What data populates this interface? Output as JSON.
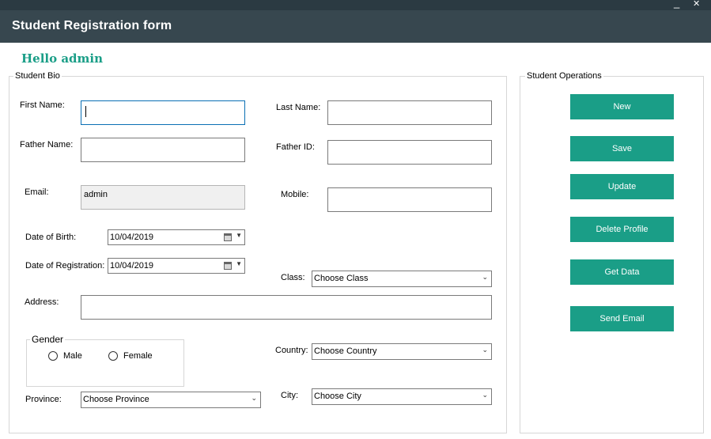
{
  "window": {
    "title": "Student Registration form",
    "minimize_glyph": "_",
    "close_glyph": "✕"
  },
  "greeting": "Hello admin",
  "bio": {
    "legend": "Student Bio",
    "first_name": {
      "label": "First Name:",
      "value": ""
    },
    "last_name": {
      "label": "Last Name:",
      "value": ""
    },
    "father_name": {
      "label": "Father Name:",
      "value": ""
    },
    "father_id": {
      "label": "Father ID:",
      "value": ""
    },
    "email": {
      "label": "Email:",
      "value": "admin"
    },
    "mobile": {
      "label": "Mobile:",
      "value": ""
    },
    "dob": {
      "label": "Date of Birth:",
      "value": "10/04/2019"
    },
    "dor": {
      "label": "Date of Registration:",
      "value": "10/04/2019"
    },
    "class": {
      "label": "Class:",
      "value": "Choose Class"
    },
    "address": {
      "label": "Address:",
      "value": ""
    },
    "gender": {
      "legend": "Gender",
      "male": "Male",
      "female": "Female"
    },
    "country": {
      "label": "Country:",
      "value": "Choose Country"
    },
    "province": {
      "label": "Province:",
      "value": "Choose Province"
    },
    "city": {
      "label": "City:",
      "value": "Choose City"
    }
  },
  "operations": {
    "legend": "Student Operations",
    "new": "New",
    "save": "Save",
    "update": "Update",
    "delete": "Delete Profile",
    "get_data": "Get Data",
    "send_email": "Send Email"
  },
  "colors": {
    "header": "#37474f",
    "accent": "#1a9e87"
  }
}
